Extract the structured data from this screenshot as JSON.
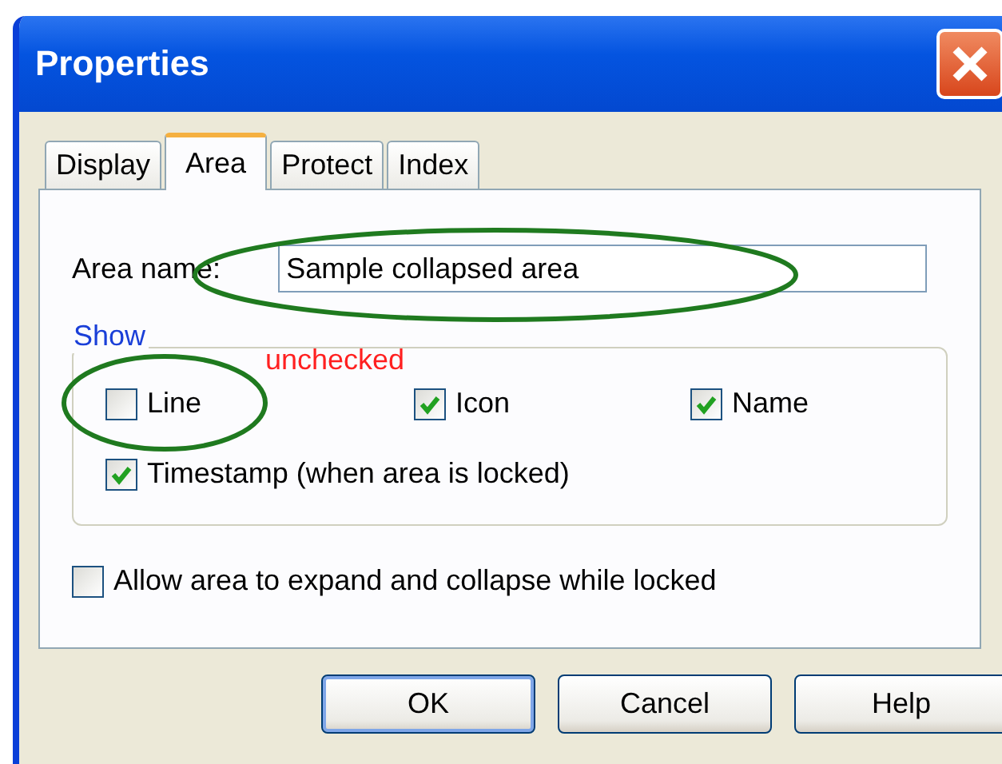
{
  "window": {
    "title": "Properties"
  },
  "tabs": [
    {
      "label": "Display",
      "selected": false
    },
    {
      "label": "Area",
      "selected": true
    },
    {
      "label": "Protect",
      "selected": false
    },
    {
      "label": "Index",
      "selected": false
    }
  ],
  "area_name": {
    "label": "Area name:",
    "value": "Sample collapsed area"
  },
  "show_group": {
    "title": "Show",
    "options": [
      {
        "label": "Line",
        "checked": false
      },
      {
        "label": "Icon",
        "checked": true
      },
      {
        "label": "Name",
        "checked": true
      },
      {
        "label": "Timestamp (when area is locked)",
        "checked": true
      }
    ]
  },
  "allow_expand": {
    "label": "Allow area to expand and collapse while locked",
    "checked": false
  },
  "annotation": {
    "text": "unchecked"
  },
  "buttons": [
    {
      "label": "OK",
      "selected": true
    },
    {
      "label": "Cancel",
      "selected": false
    },
    {
      "label": "Help",
      "selected": false
    }
  ]
}
